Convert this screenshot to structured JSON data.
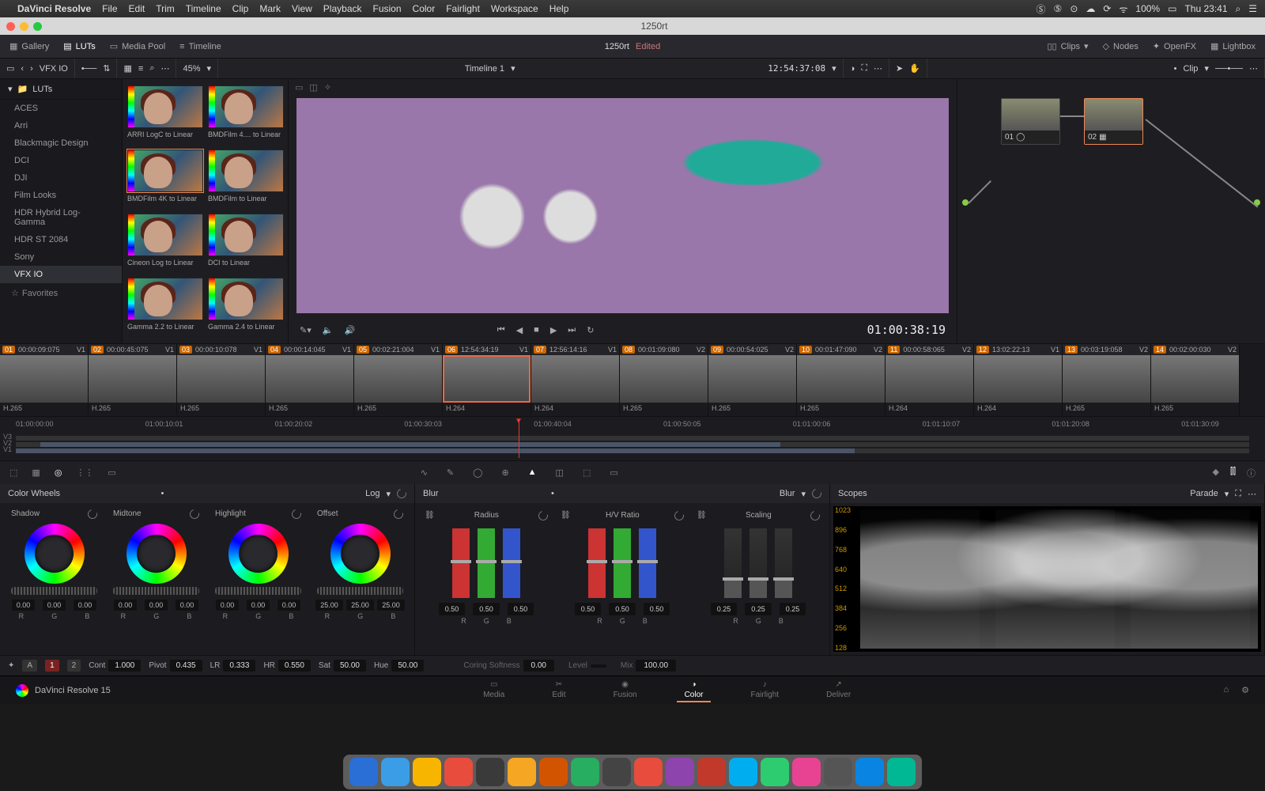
{
  "mac": {
    "app": "DaVinci Resolve",
    "menus": [
      "File",
      "Edit",
      "Trim",
      "Timeline",
      "Clip",
      "Mark",
      "View",
      "Playback",
      "Fusion",
      "Color",
      "Fairlight",
      "Workspace",
      "Help"
    ],
    "battery": "100%",
    "clock": "Thu 23:41"
  },
  "titlebar": {
    "title": "1250rt"
  },
  "apptop": {
    "buttons": {
      "gallery": "Gallery",
      "luts": "LUTs",
      "mediapool": "Media Pool",
      "timeline": "Timeline",
      "clips": "Clips",
      "nodes": "Nodes",
      "openfx": "OpenFX",
      "lightbox": "Lightbox"
    },
    "project": "1250rt",
    "edited": "Edited"
  },
  "subbar": {
    "leftlabel": "VFX IO",
    "zoom": "45%",
    "timeline": "Timeline 1",
    "tc": "12:54:37:08",
    "noderange": "Clip"
  },
  "luts": {
    "header": "LUTs",
    "cats": [
      "ACES",
      "Arri",
      "Blackmagic Design",
      "DCI",
      "DJI",
      "Film Looks",
      "HDR Hybrid Log-Gamma",
      "HDR ST 2084",
      "Sony",
      "VFX IO"
    ],
    "selected": "VFX IO",
    "fav": "Favorites",
    "items": [
      {
        "label": "ARRI LogC to Linear"
      },
      {
        "label": "BMDFilm 4.... to Linear"
      },
      {
        "label": "BMDFilm 4K to Linear",
        "sel": true
      },
      {
        "label": "BMDFilm to Linear"
      },
      {
        "label": "Cineon Log to Linear"
      },
      {
        "label": "DCI to Linear"
      },
      {
        "label": "Gamma 2.2 to Linear"
      },
      {
        "label": "Gamma 2.4 to Linear"
      }
    ]
  },
  "viewer": {
    "tc": "01:00:38:19"
  },
  "nodepanel": {
    "nodes": [
      {
        "id": "01",
        "sel": false
      },
      {
        "id": "02",
        "sel": true
      }
    ]
  },
  "clips": [
    {
      "n": "01",
      "tc": "00:00:09:075",
      "v": "V1",
      "codec": "H.265"
    },
    {
      "n": "02",
      "tc": "00:00:45:075",
      "v": "V1",
      "codec": "H.265"
    },
    {
      "n": "03",
      "tc": "00:00:10:078",
      "v": "V1",
      "codec": "H.265"
    },
    {
      "n": "04",
      "tc": "00:00:14:045",
      "v": "V1",
      "codec": "H.265"
    },
    {
      "n": "05",
      "tc": "00:02:21:004",
      "v": "V1",
      "codec": "H.265"
    },
    {
      "n": "06",
      "tc": "12:54:34:19",
      "v": "V1",
      "codec": "H.264",
      "sel": true
    },
    {
      "n": "07",
      "tc": "12:56:14:16",
      "v": "V1",
      "codec": "H.264"
    },
    {
      "n": "08",
      "tc": "00:01:09:080",
      "v": "V2",
      "codec": "H.265"
    },
    {
      "n": "09",
      "tc": "00:00:54:025",
      "v": "V2",
      "codec": "H.265"
    },
    {
      "n": "10",
      "tc": "00:01:47:090",
      "v": "V2",
      "codec": "H.265"
    },
    {
      "n": "11",
      "tc": "00:00:58:065",
      "v": "V2",
      "codec": "H.264"
    },
    {
      "n": "12",
      "tc": "13:02:22:13",
      "v": "V1",
      "codec": "H.264"
    },
    {
      "n": "13",
      "tc": "00:03:19:058",
      "v": "V2",
      "codec": "H.265"
    },
    {
      "n": "14",
      "tc": "00:02:00:030",
      "v": "V2",
      "codec": "H.265"
    }
  ],
  "minitl": {
    "marks": [
      "01:00:00:00",
      "01:00:10:01",
      "01:00:20:02",
      "01:00:30:03",
      "01:00:40:04",
      "01:00:50:05",
      "01:01:00:06",
      "01:01:10:07",
      "01:01:20:08",
      "01:01:30:09"
    ],
    "tracks": [
      "V3",
      "V2",
      "V1"
    ]
  },
  "wheels": {
    "title": "Color Wheels",
    "mode": "Log",
    "items": [
      {
        "name": "Shadow",
        "vals": [
          "0.00",
          "0.00",
          "0.00"
        ]
      },
      {
        "name": "Midtone",
        "vals": [
          "0.00",
          "0.00",
          "0.00"
        ]
      },
      {
        "name": "Highlight",
        "vals": [
          "0.00",
          "0.00",
          "0.00"
        ]
      },
      {
        "name": "Offset",
        "vals": [
          "25.00",
          "25.00",
          "25.00"
        ]
      }
    ],
    "rgb": [
      "R",
      "G",
      "B"
    ]
  },
  "blur": {
    "title": "Blur",
    "mode": "Blur",
    "cols": [
      {
        "name": "Radius",
        "vals": [
          "0.50",
          "0.50",
          "0.50"
        ],
        "rgb": true
      },
      {
        "name": "H/V Ratio",
        "vals": [
          "0.50",
          "0.50",
          "0.50"
        ],
        "rgb": true
      },
      {
        "name": "Scaling",
        "vals": [
          "0.25",
          "0.25",
          "0.25"
        ],
        "rgb": false
      }
    ],
    "extra": {
      "coring": "Coring Softness",
      "coringv": "0.00",
      "level": "Level",
      "mix": "Mix",
      "mixv": "100.00"
    }
  },
  "scopes": {
    "title": "Scopes",
    "mode": "Parade",
    "y": [
      "1023",
      "896",
      "768",
      "640",
      "512",
      "384",
      "256",
      "128"
    ]
  },
  "params": {
    "pg": [
      "1",
      "2"
    ],
    "cont": {
      "l": "Cont",
      "v": "1.000"
    },
    "pivot": {
      "l": "Pivot",
      "v": "0.435"
    },
    "lr": {
      "l": "LR",
      "v": "0.333"
    },
    "hr": {
      "l": "HR",
      "v": "0.550"
    },
    "sat": {
      "l": "Sat",
      "v": "50.00"
    },
    "hue": {
      "l": "Hue",
      "v": "50.00"
    }
  },
  "pagenav": {
    "brand": "DaVinci Resolve 15",
    "pages": [
      "Media",
      "Edit",
      "Fusion",
      "Color",
      "Fairlight",
      "Deliver"
    ],
    "active": "Color"
  },
  "dock_count": 18
}
